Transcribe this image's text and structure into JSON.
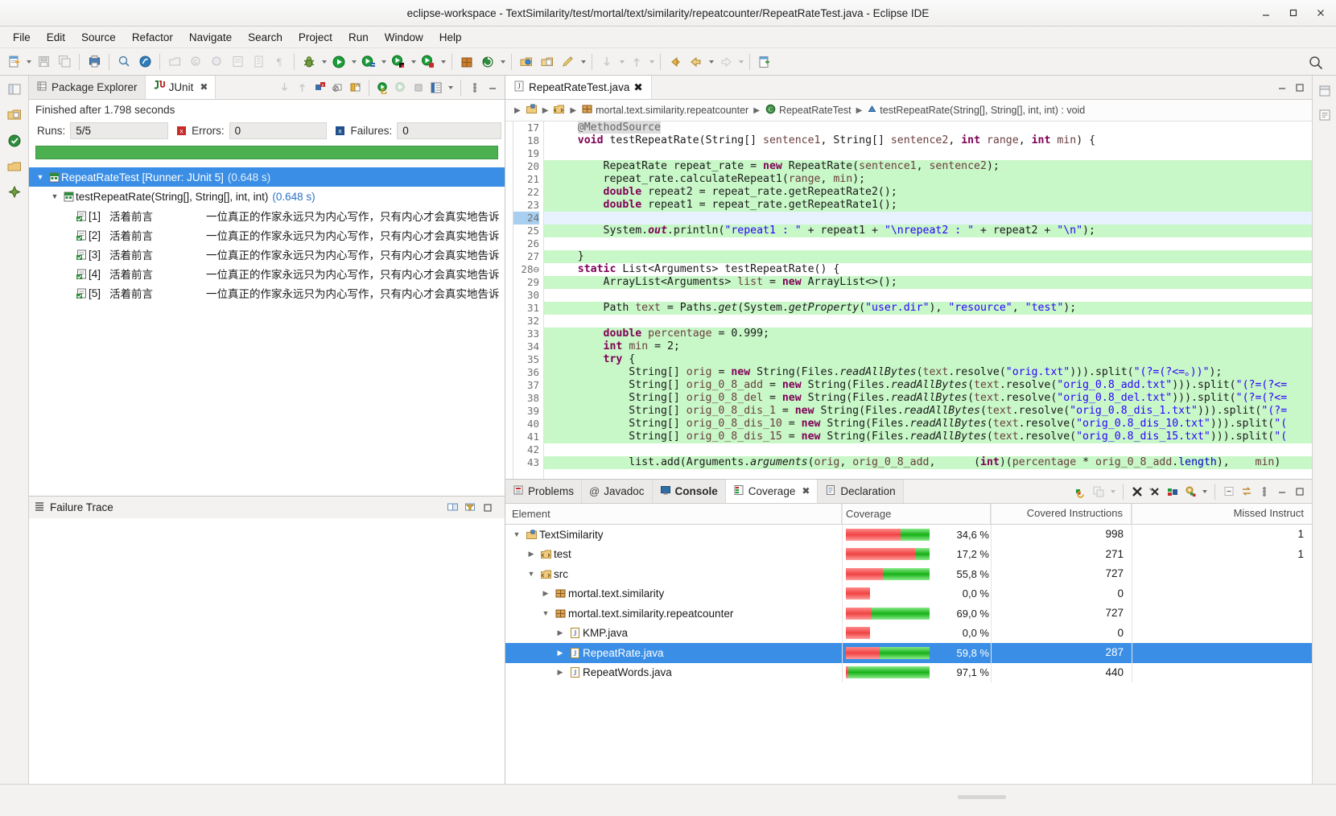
{
  "window": {
    "title": "eclipse-workspace - TextSimilarity/test/mortal/text/similarity/repeatcounter/RepeatRateTest.java - Eclipse IDE",
    "minimize_label": "Minimize",
    "maximize_label": "Maximize",
    "close_label": "Close"
  },
  "menubar": {
    "items": [
      {
        "label": "File"
      },
      {
        "label": "Edit"
      },
      {
        "label": "Source"
      },
      {
        "label": "Refactor"
      },
      {
        "label": "Navigate"
      },
      {
        "label": "Search"
      },
      {
        "label": "Project"
      },
      {
        "label": "Run"
      },
      {
        "label": "Window"
      },
      {
        "label": "Help"
      }
    ]
  },
  "toolbar": {
    "icons": [
      "new-wizard-icon",
      "save-icon",
      "save-all-icon",
      "print-icon",
      "toggle-mark-occurrences-icon",
      "link-with-editor-icon",
      "new-java-package-icon",
      "new-java-class-icon",
      "new-java-interface-icon",
      "open-type-icon",
      "open-task-icon",
      "pilcrow-icon",
      "debug-icon",
      "run-icon",
      "coverage-icon",
      "run-last-icon",
      "external-tools-icon",
      "new-java-project-icon",
      "refresh-icon",
      "open-perspective-icon",
      "open-resource-icon",
      "pencil-icon",
      "next-annotation-icon",
      "previous-annotation-icon",
      "back-icon",
      "forward-icon",
      "next-edit-icon",
      "new-editor-icon",
      "search-icon"
    ]
  },
  "junit": {
    "tabs": [
      {
        "label": "Package Explorer",
        "icon": "package-explorer-icon",
        "active": false,
        "closable": false
      },
      {
        "label": "JUnit",
        "icon": "junit-icon",
        "active": true,
        "closable": true
      }
    ],
    "tools": [
      "next-failure-icon",
      "previous-failure-icon",
      "show-failures-only-icon",
      "show-ignored-icon",
      "lock-scroll-icon",
      "rerun-test-icon",
      "rerun-failed-icon",
      "stop-icon",
      "test-history-icon",
      "view-menu-icon",
      "minimize-icon"
    ],
    "status": "Finished after 1.798 seconds",
    "counters": {
      "runs_label": "Runs:",
      "runs_value": "5/5",
      "errors_label": "Errors:",
      "errors_value": "0",
      "failures_label": "Failures:",
      "failures_value": "0"
    },
    "progress": {
      "percent": 100,
      "color": "#4caf50"
    },
    "tree": [
      {
        "depth": 0,
        "twisty": "expanded",
        "icon": "test-suite-ok-icon",
        "label": "RepeatRateTest [Runner: JUnit 5]",
        "time": "(0.648 s)",
        "selected": true
      },
      {
        "depth": 1,
        "twisty": "expanded",
        "icon": "test-suite-ok-icon",
        "label": "testRepeatRate(String[], String[], int, int)",
        "time": "(0.648 s)",
        "selected": false
      },
      {
        "depth": 2,
        "twisty": "none",
        "icon": "test-ok-icon",
        "selected": false,
        "index": "[1]",
        "arg1": "活着前言",
        "label": "一位真正的作家永远只为内心写作，只有内心才会真实地告诉",
        "time": ""
      },
      {
        "depth": 2,
        "twisty": "none",
        "icon": "test-ok-icon",
        "selected": false,
        "index": "[2]",
        "arg1": "活着前言",
        "label": "一位真正的作家永远只为内心写作，只有内心才会真实地告诉",
        "time": ""
      },
      {
        "depth": 2,
        "twisty": "none",
        "icon": "test-ok-icon",
        "selected": false,
        "index": "[3]",
        "arg1": "活着前言",
        "label": "一位真正的作家永远只为内心写作，只有内心才会真实地告诉",
        "time": ""
      },
      {
        "depth": 2,
        "twisty": "none",
        "icon": "test-ok-icon",
        "selected": false,
        "index": "[4]",
        "arg1": "活着前言",
        "label": "一位真正的作家永远只为内心写作，只有内心才会真实地告诉",
        "time": ""
      },
      {
        "depth": 2,
        "twisty": "none",
        "icon": "test-ok-icon",
        "selected": false,
        "index": "[5]",
        "arg1": "活着前言",
        "label": "一位真正的作家永远只为内心写作，只有内心才会真实地告诉",
        "time": ""
      }
    ],
    "failure_trace": {
      "title": "Failure Trace",
      "icon": "failure-trace-icon",
      "tools": [
        "compare-result-icon",
        "filter-stacktrace-icon",
        "maximize-icon"
      ],
      "content": ""
    }
  },
  "editor": {
    "tab": {
      "label": "RepeatRateTest.java",
      "icon": "java-file-icon",
      "close": "✕"
    },
    "tools": [
      "minimize-icon",
      "maximize-icon"
    ],
    "breadcrumb": [
      {
        "label": "",
        "icon": "project-icon"
      },
      {
        "label": "",
        "icon": "source-folder-icon"
      },
      {
        "label": "mortal.text.similarity.repeatcounter",
        "icon": "package-icon"
      },
      {
        "label": "RepeatRateTest",
        "icon": "class-icon"
      },
      {
        "label": "testRepeatRate(String[], String[], int, int) : void",
        "icon": "method-icon"
      }
    ],
    "first_line": 17,
    "lines": [
      {
        "n": 17,
        "cov": "none",
        "cur": false,
        "fold": false,
        "html": "    <span class=\"annhi\">@MethodSource</span>"
      },
      {
        "n": 18,
        "cov": "none",
        "cur": false,
        "fold": false,
        "html": "    <span class=\"kw\">void</span> testRepeatRate(String[] <span class=\"param\">sentence1</span>, String[] <span class=\"param\">sentence2</span>, <span class=\"kw\">int</span> <span class=\"param\">range</span>, <span class=\"kw\">int</span> <span class=\"param\">min</span>) {"
      },
      {
        "n": 19,
        "cov": "none",
        "cur": false,
        "fold": false,
        "html": ""
      },
      {
        "n": 20,
        "cov": "covered",
        "cur": false,
        "fold": false,
        "html": "        RepeatRate repeat_rate = <span class=\"kw\">new</span> RepeatRate(<span class=\"param\">sentence1</span>, <span class=\"param\">sentence2</span>);"
      },
      {
        "n": 21,
        "cov": "covered",
        "cur": false,
        "fold": false,
        "html": "        repeat_rate.calculateRepeat1(<span class=\"param\">range</span>, <span class=\"param\">min</span>);"
      },
      {
        "n": 22,
        "cov": "covered",
        "cur": false,
        "fold": false,
        "html": "        <span class=\"kw\">double</span> repeat2 = repeat_rate.getRepeatRate2();"
      },
      {
        "n": 23,
        "cov": "covered",
        "cur": false,
        "fold": false,
        "html": "        <span class=\"kw\">double</span> repeat1 = repeat_rate.getRepeatRate1();"
      },
      {
        "n": 24,
        "cov": "none",
        "cur": true,
        "fold": false,
        "html": ""
      },
      {
        "n": 25,
        "cov": "covered",
        "cur": false,
        "fold": false,
        "html": "        System.<span class=\"statb\">out</span>.println(<span class=\"str\">\"repeat1 : \"</span> + repeat1 + <span class=\"str\">\"\\nrepeat2 : \"</span> + repeat2 + <span class=\"str\">\"\\n\"</span>);"
      },
      {
        "n": 26,
        "cov": "none",
        "cur": false,
        "fold": false,
        "html": ""
      },
      {
        "n": 27,
        "cov": "covered",
        "cur": false,
        "fold": false,
        "html": "    }"
      },
      {
        "n": 28,
        "cov": "none",
        "cur": false,
        "fold": true,
        "html": "    <span class=\"kw\">static</span> List&lt;Arguments&gt; testRepeatRate() {"
      },
      {
        "n": 29,
        "cov": "covered",
        "cur": false,
        "fold": false,
        "html": "        ArrayList&lt;Arguments&gt; <span class=\"param\">list</span> = <span class=\"kw\">new</span> ArrayList&lt;&gt;();"
      },
      {
        "n": 30,
        "cov": "none",
        "cur": false,
        "fold": false,
        "html": ""
      },
      {
        "n": 31,
        "cov": "covered",
        "cur": false,
        "fold": false,
        "html": "        Path <span class=\"param\">text</span> = Paths.<span class=\"stat\">get</span>(System.<span class=\"stat\">getProperty</span>(<span class=\"str\">\"user.dir\"</span>), <span class=\"str\">\"resource\"</span>, <span class=\"str\">\"test\"</span>);"
      },
      {
        "n": 32,
        "cov": "none",
        "cur": false,
        "fold": false,
        "html": ""
      },
      {
        "n": 33,
        "cov": "covered",
        "cur": false,
        "fold": false,
        "html": "        <span class=\"kw\">double</span> <span class=\"param\">percentage</span> = 0.999;"
      },
      {
        "n": 34,
        "cov": "covered",
        "cur": false,
        "fold": false,
        "html": "        <span class=\"kw\">int</span> <span class=\"param\">min</span> = 2;"
      },
      {
        "n": 35,
        "cov": "covered",
        "cur": false,
        "fold": false,
        "html": "        <span class=\"kw\">try</span> {"
      },
      {
        "n": 36,
        "cov": "covered",
        "cur": false,
        "fold": false,
        "html": "            String[] <span class=\"param\">orig</span> = <span class=\"kw\">new</span> String(Files.<span class=\"stat\">readAllBytes</span>(<span class=\"param\">text</span>.resolve(<span class=\"str\">\"orig.txt\"</span>))).split(<span class=\"str\">\"(?=(?&lt;=。))\"</span>);"
      },
      {
        "n": 37,
        "cov": "covered",
        "cur": false,
        "fold": false,
        "html": "            String[] <span class=\"param\">orig_0_8_add</span> = <span class=\"kw\">new</span> String(Files.<span class=\"stat\">readAllBytes</span>(<span class=\"param\">text</span>.resolve(<span class=\"str\">\"orig_0.8_add.txt\"</span>))).split(<span class=\"str\">\"(?=(?&lt;=</span>"
      },
      {
        "n": 38,
        "cov": "covered",
        "cur": false,
        "fold": false,
        "html": "            String[] <span class=\"param\">orig_0_8_del</span> = <span class=\"kw\">new</span> String(Files.<span class=\"stat\">readAllBytes</span>(<span class=\"param\">text</span>.resolve(<span class=\"str\">\"orig_0.8_del.txt\"</span>))).split(<span class=\"str\">\"(?=(?&lt;=</span>"
      },
      {
        "n": 39,
        "cov": "covered",
        "cur": false,
        "fold": false,
        "html": "            String[] <span class=\"param\">orig_0_8_dis_1</span> = <span class=\"kw\">new</span> String(Files.<span class=\"stat\">readAllBytes</span>(<span class=\"param\">text</span>.resolve(<span class=\"str\">\"orig_0.8_dis_1.txt\"</span>))).split(<span class=\"str\">\"(?=</span>"
      },
      {
        "n": 40,
        "cov": "covered",
        "cur": false,
        "fold": false,
        "html": "            String[] <span class=\"param\">orig_0_8_dis_10</span> = <span class=\"kw\">new</span> String(Files.<span class=\"stat\">readAllBytes</span>(<span class=\"param\">text</span>.resolve(<span class=\"str\">\"orig_0.8_dis_10.txt\"</span>))).split(<span class=\"str\">\"(</span>"
      },
      {
        "n": 41,
        "cov": "covered",
        "cur": false,
        "fold": false,
        "html": "            String[] <span class=\"param\">orig_0_8_dis_15</span> = <span class=\"kw\">new</span> String(Files.<span class=\"stat\">readAllBytes</span>(<span class=\"param\">text</span>.resolve(<span class=\"str\">\"orig_0.8_dis_15.txt\"</span>))).split(<span class=\"str\">\"(</span>"
      },
      {
        "n": 42,
        "cov": "none",
        "cur": false,
        "fold": false,
        "html": ""
      },
      {
        "n": 43,
        "cov": "covered",
        "cur": false,
        "fold": false,
        "html": "            list.add(Arguments.<span class=\"stat\">arguments</span>(<span class=\"param\">orig</span>, <span class=\"param\">orig_0_8_add</span>,      (<span class=\"kw\">int</span>)(<span class=\"param\">percentage</span> * <span class=\"param\">orig_0_8_add</span>.<span class=\"fld\">length</span>),    <span class=\"param\">min</span>)"
      }
    ]
  },
  "bottom": {
    "tabs": [
      {
        "label": "Problems",
        "icon": "problems-icon",
        "active": false,
        "bold": false,
        "closable": false
      },
      {
        "label": "Javadoc",
        "icon": "javadoc-icon",
        "active": false,
        "bold": false,
        "closable": false
      },
      {
        "label": "Console",
        "icon": "console-icon",
        "active": false,
        "bold": true,
        "closable": false
      },
      {
        "label": "Coverage",
        "icon": "coverage-icon",
        "active": true,
        "bold": false,
        "closable": true
      },
      {
        "label": "Declaration",
        "icon": "declaration-icon",
        "active": false,
        "bold": false,
        "closable": false
      }
    ],
    "tools": [
      "relaunch-coverage-icon",
      "merge-sessions-icon",
      "remove-session-icon",
      "remove-all-sessions-icon",
      "import-session-icon",
      "coverage-settings-icon",
      "collapse-all-icon",
      "link-with-selection-icon",
      "view-menu-icon",
      "minimize-icon",
      "maximize-icon"
    ],
    "coverage": {
      "columns": [
        "Element",
        "Coverage",
        "Covered Instructions",
        "Missed Instruct"
      ],
      "rows": [
        {
          "depth": 0,
          "twisty": "expanded",
          "icon": "project-icon",
          "label": "TextSimilarity",
          "percent": "34,6 %",
          "covered_ratio": 34.6,
          "covered": "998",
          "missed": "1",
          "selected": false
        },
        {
          "depth": 1,
          "twisty": "collapsed",
          "icon": "source-folder-icon",
          "label": "test",
          "percent": "17,2 %",
          "covered_ratio": 17.2,
          "covered": "271",
          "missed": "1",
          "selected": false
        },
        {
          "depth": 1,
          "twisty": "expanded",
          "icon": "source-folder-icon",
          "label": "src",
          "percent": "55,8 %",
          "covered_ratio": 55.8,
          "covered": "727",
          "missed": "",
          "selected": false
        },
        {
          "depth": 2,
          "twisty": "collapsed",
          "icon": "package-icon",
          "label": "mortal.text.similarity",
          "percent": "0,0 %",
          "covered_ratio": 0,
          "covered": "0",
          "missed": "",
          "selected": false
        },
        {
          "depth": 2,
          "twisty": "expanded",
          "icon": "package-icon",
          "label": "mortal.text.similarity.repeatcounter",
          "percent": "69,0 %",
          "covered_ratio": 69.0,
          "covered": "727",
          "missed": "",
          "selected": false
        },
        {
          "depth": 3,
          "twisty": "collapsed",
          "icon": "java-file-icon",
          "label": "KMP.java",
          "percent": "0,0 %",
          "covered_ratio": 0,
          "covered": "0",
          "missed": "",
          "selected": false
        },
        {
          "depth": 3,
          "twisty": "collapsed",
          "icon": "java-file-icon",
          "label": "RepeatRate.java",
          "percent": "59,8 %",
          "covered_ratio": 59.8,
          "covered": "287",
          "missed": "",
          "selected": true
        },
        {
          "depth": 3,
          "twisty": "collapsed",
          "icon": "java-file-icon",
          "label": "RepeatWords.java",
          "percent": "97,1 %",
          "covered_ratio": 97.1,
          "covered": "440",
          "missed": "",
          "selected": false
        }
      ]
    }
  },
  "colors": {
    "accent": "#3a8ee6",
    "progress_green": "#4caf50",
    "coverage_red": "#f04343",
    "coverage_green": "#17b117",
    "keyword": "#7f0055",
    "string": "#2a00ff",
    "covered_line": "#c8f7c8",
    "chrome": "#f3f2f1"
  }
}
